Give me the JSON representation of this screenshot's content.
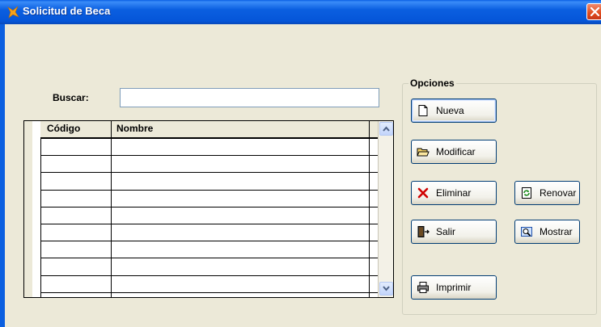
{
  "window": {
    "title": "Solicitud de Beca"
  },
  "search": {
    "label": "Buscar:",
    "value": ""
  },
  "grid": {
    "columns": [
      "Código",
      "Nombre"
    ],
    "rows": [
      [
        "",
        ""
      ],
      [
        "",
        ""
      ],
      [
        "",
        ""
      ],
      [
        "",
        ""
      ],
      [
        "",
        ""
      ],
      [
        "",
        ""
      ],
      [
        "",
        ""
      ],
      [
        "",
        ""
      ],
      [
        "",
        ""
      ]
    ]
  },
  "options": {
    "legend": "Opciones",
    "buttons": {
      "nueva": "Nueva",
      "modificar": "Modificar",
      "eliminar": "Eliminar",
      "renovar": "Renovar",
      "salir": "Salir",
      "mostrar": "Mostrar",
      "imprimir": "Imprimir"
    }
  },
  "icons": {
    "title": "app-icon",
    "nueva": "new-document-icon",
    "modificar": "open-folder-icon",
    "eliminar": "delete-x-icon",
    "renovar": "renew-icon",
    "salir": "exit-door-icon",
    "mostrar": "preview-icon",
    "imprimir": "printer-icon"
  },
  "colors": {
    "titlebar": "#0b5fe0",
    "window_bg": "#ece9d8",
    "delete_red": "#d00000"
  }
}
